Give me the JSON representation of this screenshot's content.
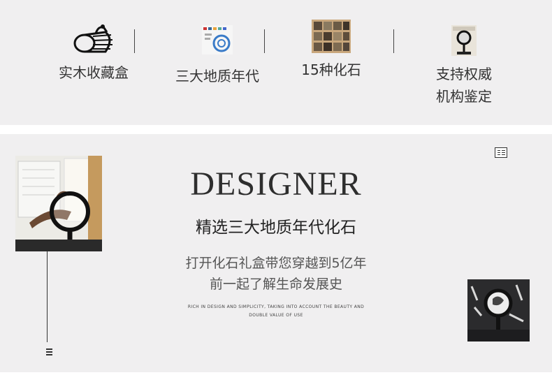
{
  "features": [
    {
      "label": "实木收藏盒",
      "icon": "wooden-box-icon"
    },
    {
      "label": "三大地质年代",
      "icon": "geologic-eras-image"
    },
    {
      "label": "15种化石",
      "icon": "fossil-tray-image"
    },
    {
      "label_line1": "支持权威",
      "label_line2": "机构鉴定",
      "icon": "magnifier-image"
    }
  ],
  "designer": {
    "title": "DESIGNER",
    "subtitle": "精选三大地质年代化石",
    "para_line1": "打开化石礼盒带您穿越到5亿年",
    "para_line2": "前一起了解生命发展史",
    "small_line1": "RICH IN DESIGN AND SIMPLICITY, TAKING INTO ACCOUNT THE BEAUTY AND",
    "small_line2": "DOUBLE VALUE OF USE"
  },
  "colors": {
    "band": "#f0eff0",
    "text": "#333333"
  }
}
